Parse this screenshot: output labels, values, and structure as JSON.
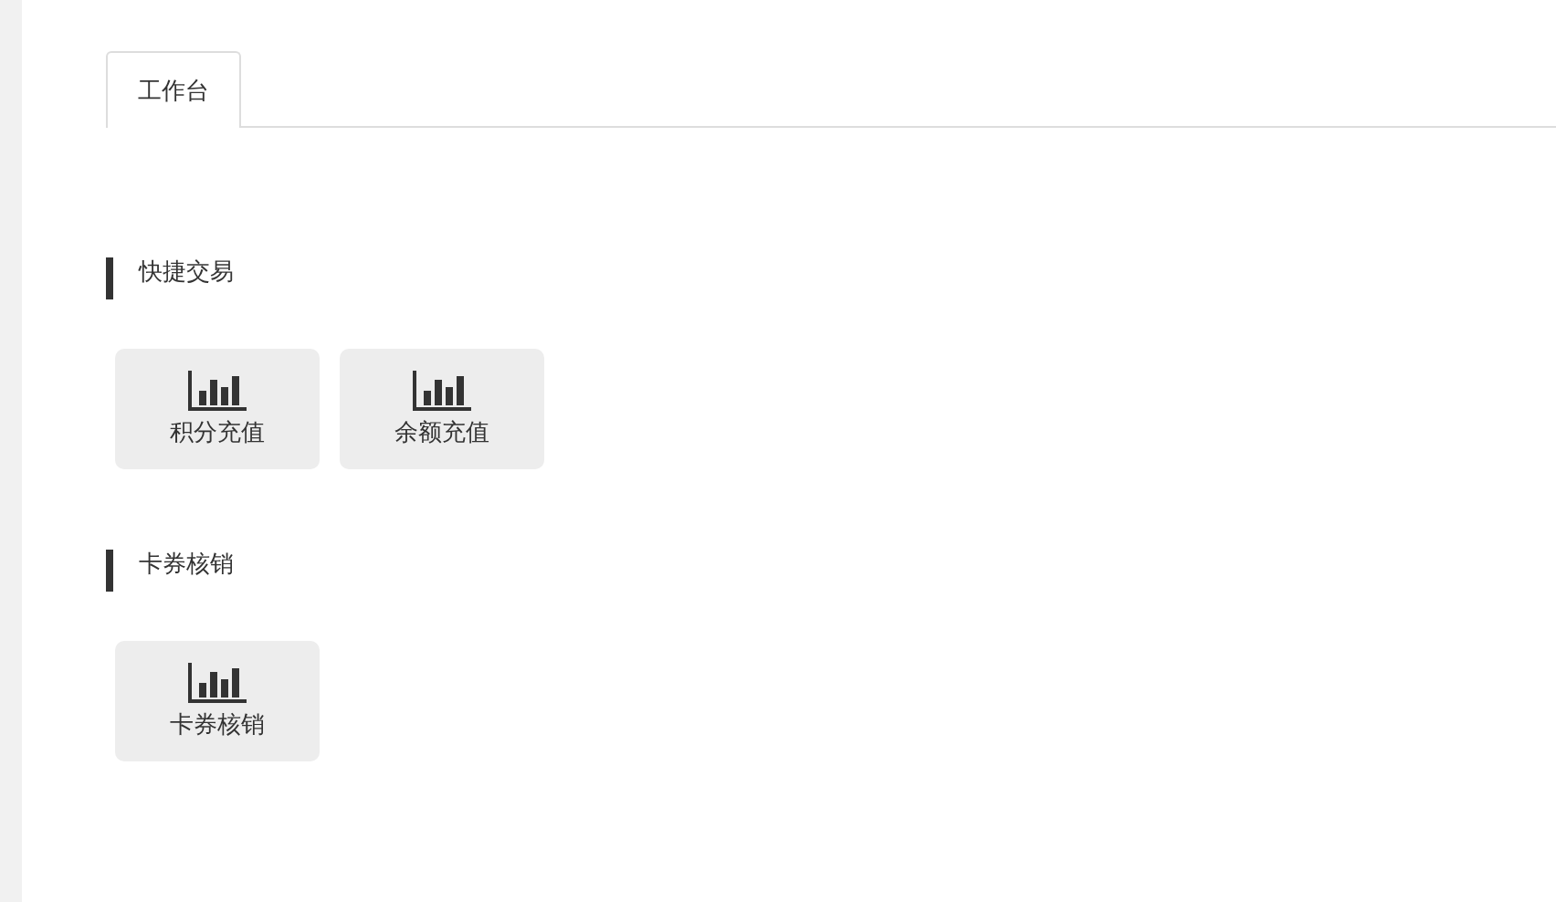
{
  "tabs": [
    {
      "label": "工作台",
      "selected": true
    }
  ],
  "sections": [
    {
      "title": "快捷交易",
      "tiles": [
        {
          "label": "积分充值"
        },
        {
          "label": "余额充值"
        }
      ]
    },
    {
      "title": "卡券核销",
      "tiles": [
        {
          "label": "卡券核销"
        }
      ]
    }
  ]
}
